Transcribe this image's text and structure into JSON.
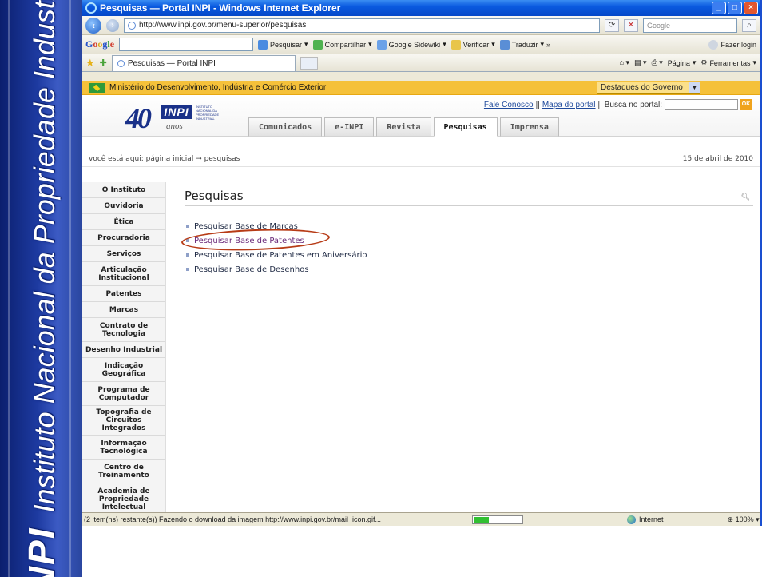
{
  "slide": {
    "logo_text": "INPI",
    "banner_text": "Instituto Nacional da Propriedade Industrial"
  },
  "browser": {
    "title": "Pesquisas — Portal INPI - Windows Internet Explorer",
    "address": "http://www.inpi.gov.br/menu-superior/pesquisas",
    "search_placeholder": "Google",
    "tab_title": "Pesquisas — Portal INPI",
    "toolbar": {
      "google": "Google",
      "pesquisar": "Pesquisar",
      "compartilhar": "Compartilhar",
      "sidewiki": "Google Sidewiki",
      "verificar": "Verificar",
      "traduzir": "Traduzir",
      "more": "»",
      "login": "Fazer login"
    },
    "command": {
      "pagina": "Página",
      "ferramentas": "Ferramentas"
    }
  },
  "gov_bar": {
    "label": "Ministério do Desenvolvimento, Indústria e Comércio Exterior",
    "select": "Destaques do Governo"
  },
  "header": {
    "logo_number": "40",
    "logo_brand": "INPI",
    "logo_small": "INSTITUTO NACIONAL DA PROPRIEDADE INDUSTRIAL",
    "logo_anos": "anos",
    "links": {
      "fale": "Fale Conosco",
      "mapa": "Mapa do portal",
      "sep": "||",
      "busca": "Busca no portal:",
      "ok": "OK"
    }
  },
  "nav_tabs": [
    {
      "label": "Comunicados"
    },
    {
      "label": "e-INPI"
    },
    {
      "label": "Revista"
    },
    {
      "label": "Pesquisas"
    },
    {
      "label": "Imprensa"
    }
  ],
  "breadcrumb": {
    "text": "você está aqui: página inicial → pesquisas",
    "date": "15 de abril de 2010"
  },
  "sidebar": [
    {
      "label": "O Instituto"
    },
    {
      "label": "Ouvidoria"
    },
    {
      "label": "Ética"
    },
    {
      "label": "Procuradoria"
    },
    {
      "label": "Serviços"
    },
    {
      "label": "Articulação Institucional"
    },
    {
      "label": "Patentes"
    },
    {
      "label": "Marcas"
    },
    {
      "label": "Contrato de Tecnologia"
    },
    {
      "label": "Desenho Industrial"
    },
    {
      "label": "Indicação Geográfica"
    },
    {
      "label": "Programa de Computador"
    },
    {
      "label": "Topografia de Circuitos Integrados"
    },
    {
      "label": "Informação Tecnológica"
    },
    {
      "label": "Centro de Treinamento"
    },
    {
      "label": "Academia de Propriedade Intelectual"
    }
  ],
  "content": {
    "title": "Pesquisas",
    "links": [
      {
        "label": "Pesquisar Base de Marcas"
      },
      {
        "label": "Pesquisar Base de Patentes"
      },
      {
        "label": "Pesquisar Base de Patentes em Aniversário"
      },
      {
        "label": "Pesquisar Base de Desenhos"
      }
    ]
  },
  "statusbar": {
    "message": "(2 item(ns) restante(s)) Fazendo o download da imagem http://www.inpi.gov.br/mail_icon.gif...",
    "zone": "Internet",
    "zoom": "100%",
    "progress": 0.3
  },
  "colors": {
    "highlight_ring": "#b73b16",
    "gov_bar": "#f5c13a",
    "banner": "#1d3aa0"
  }
}
